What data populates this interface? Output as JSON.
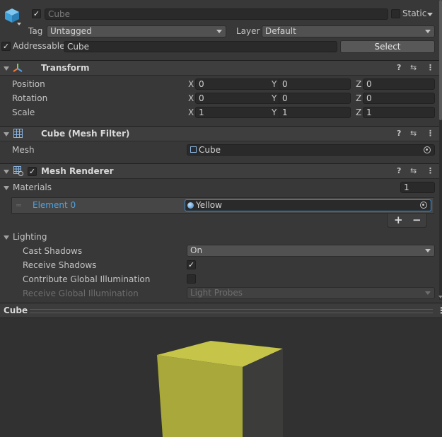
{
  "object": {
    "name": "Cube",
    "static_label": "Static",
    "tag_label": "Tag",
    "tag_value": "Untagged",
    "layer_label": "Layer",
    "layer_value": "Default",
    "addressable_label": "Addressable",
    "addressable_value": "Cube",
    "select_button": "Select"
  },
  "transform": {
    "title": "Transform",
    "rows": [
      {
        "label": "Position",
        "x": "0",
        "y": "0",
        "z": "0"
      },
      {
        "label": "Rotation",
        "x": "0",
        "y": "0",
        "z": "0"
      },
      {
        "label": "Scale",
        "x": "1",
        "y": "1",
        "z": "1"
      }
    ],
    "axes": {
      "x": "X",
      "y": "Y",
      "z": "Z"
    }
  },
  "mesh_filter": {
    "title": "Cube (Mesh Filter)",
    "mesh_label": "Mesh",
    "mesh_value": "Cube"
  },
  "mesh_renderer": {
    "title": "Mesh Renderer",
    "materials_label": "Materials",
    "materials_count": "1",
    "element_label": "Element 0",
    "element_value": "Yellow",
    "add": "+",
    "remove": "−",
    "lighting_label": "Lighting",
    "cast_shadows_label": "Cast Shadows",
    "cast_shadows_value": "On",
    "receive_shadows_label": "Receive Shadows",
    "contribute_gi_label": "Contribute Global Illumination",
    "receive_gi_label": "Receive Global Illumination",
    "receive_gi_value": "Light Probes"
  },
  "preview": {
    "title": "Cube",
    "cube_front": "#a9a83a",
    "cube_top": "#c6c54a",
    "cube_side": "#3c3c3a"
  },
  "icons": {
    "help": "?",
    "presets": "⇆",
    "menu": "⋮"
  }
}
